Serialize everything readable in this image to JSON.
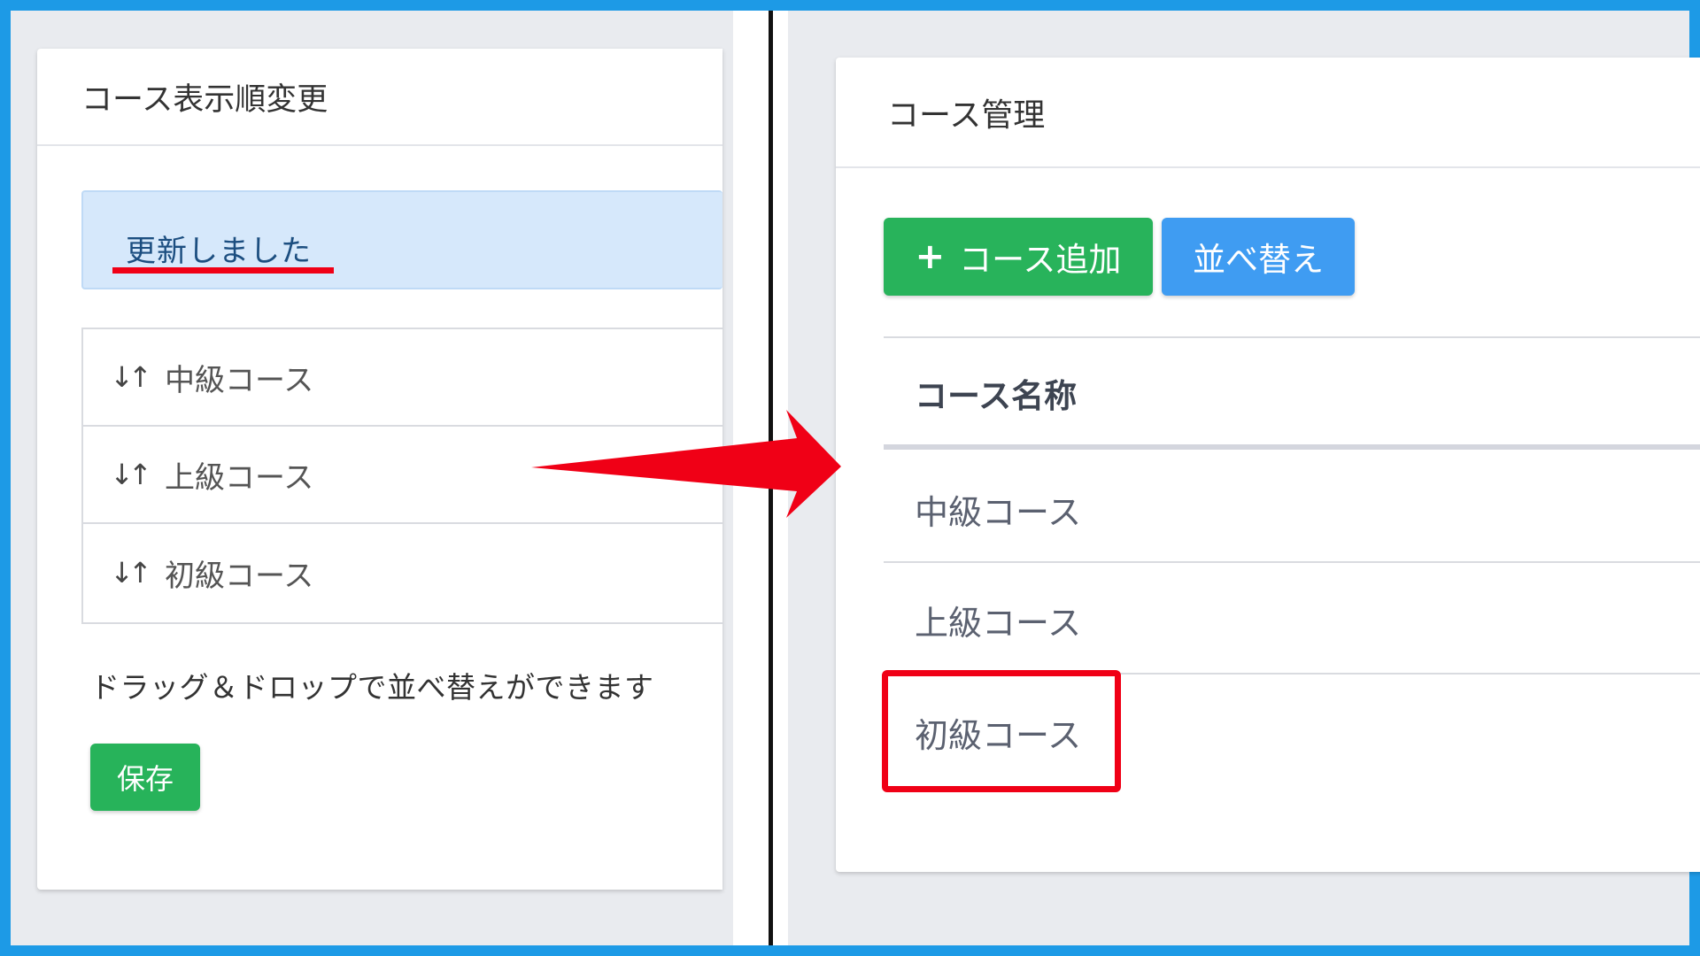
{
  "left_panel": {
    "card_title": "コース表示順変更",
    "alert_message": "更新しました",
    "sort_items": [
      {
        "label": "中級コース"
      },
      {
        "label": "上級コース"
      },
      {
        "label": "初級コース"
      }
    ],
    "hint": "ドラッグ＆ドロップで並べ替えができます",
    "save_label": "保存"
  },
  "right_panel": {
    "card_title": "コース管理",
    "add_label": "コース追加",
    "sort_label": "並べ替え",
    "column_header": "コース名称",
    "rows": [
      {
        "name": "中級コース"
      },
      {
        "name": "上級コース"
      },
      {
        "name": "初級コース"
      }
    ]
  },
  "colors": {
    "frame_border": "#1d9ae6",
    "annotation_red": "#f00016",
    "success_green": "#27b35a",
    "primary_blue": "#3f9cf2",
    "alert_bg": "#d6e8fb"
  },
  "icons": {
    "sort_handle": "sort-updown-icon",
    "plus": "plus-icon",
    "transition_arrow": "arrow-right-icon"
  }
}
